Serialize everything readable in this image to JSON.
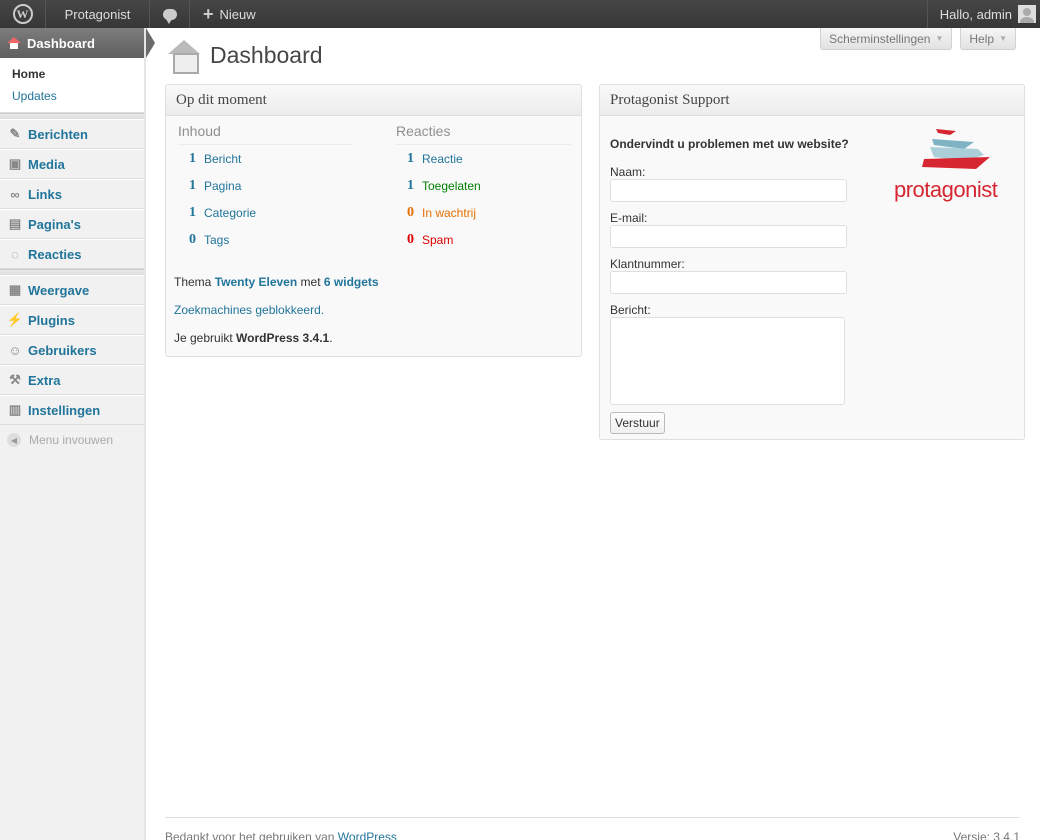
{
  "adminbar": {
    "site_name": "Protagonist",
    "new_label": "Nieuw",
    "greeting": "Hallo, admin"
  },
  "sidebar": {
    "dashboard_label": "Dashboard",
    "submenu": [
      {
        "label": "Home",
        "current": true
      },
      {
        "label": "Updates",
        "current": false
      }
    ],
    "group1": [
      {
        "label": "Berichten",
        "icon": "pushpin-icon"
      },
      {
        "label": "Media",
        "icon": "media-icon"
      },
      {
        "label": "Links",
        "icon": "link-icon"
      },
      {
        "label": "Pagina's",
        "icon": "page-icon"
      },
      {
        "label": "Reacties",
        "icon": "comment-icon"
      }
    ],
    "group2": [
      {
        "label": "Weergave",
        "icon": "appearance-icon"
      },
      {
        "label": "Plugins",
        "icon": "plugin-icon"
      },
      {
        "label": "Gebruikers",
        "icon": "users-icon"
      },
      {
        "label": "Extra",
        "icon": "tools-icon"
      },
      {
        "label": "Instellingen",
        "icon": "settings-icon"
      }
    ],
    "collapse_label": "Menu invouwen"
  },
  "header": {
    "title": "Dashboard",
    "screen_options": "Scherminstellingen",
    "help": "Help"
  },
  "right_now": {
    "title": "Op dit moment",
    "content_head": "Inhoud",
    "discussion_head": "Reacties",
    "content": [
      {
        "num": "1",
        "label": "Bericht"
      },
      {
        "num": "1",
        "label": "Pagina"
      },
      {
        "num": "1",
        "label": "Categorie"
      },
      {
        "num": "0",
        "label": "Tags"
      }
    ],
    "discussion": [
      {
        "num": "1",
        "label": "Reactie",
        "status": "default"
      },
      {
        "num": "1",
        "label": "Toegelaten",
        "status": "approved"
      },
      {
        "num": "0",
        "label": "In wachtrij",
        "status": "pending"
      },
      {
        "num": "0",
        "label": "Spam",
        "status": "spam"
      }
    ],
    "theme_prefix": "Thema",
    "theme_name": "Twenty Eleven",
    "theme_mid": "met",
    "widgets": "6 widgets",
    "search_blocked": "Zoekmachines geblokkeerd.",
    "version_prefix": "Je gebruikt",
    "version": "WordPress 3.4.1",
    "version_suffix": "."
  },
  "support": {
    "title": "Protagonist Support",
    "question": "Ondervindt u problemen met uw website?",
    "name_label": "Naam:",
    "email_label": "E-mail:",
    "customer_label": "Klantnummer:",
    "message_label": "Bericht:",
    "send_label": "Verstuur",
    "logo_text": "protagonist"
  },
  "footer": {
    "thanks": "Bedankt voor het gebruiken van",
    "wp_link": "WordPress",
    "version": "Versie: 3.4.1"
  },
  "colors": {
    "link": "#21759b",
    "approved": "#008000",
    "pending": "#e66f00",
    "spam": "#d00000",
    "brand": "#d62631"
  }
}
